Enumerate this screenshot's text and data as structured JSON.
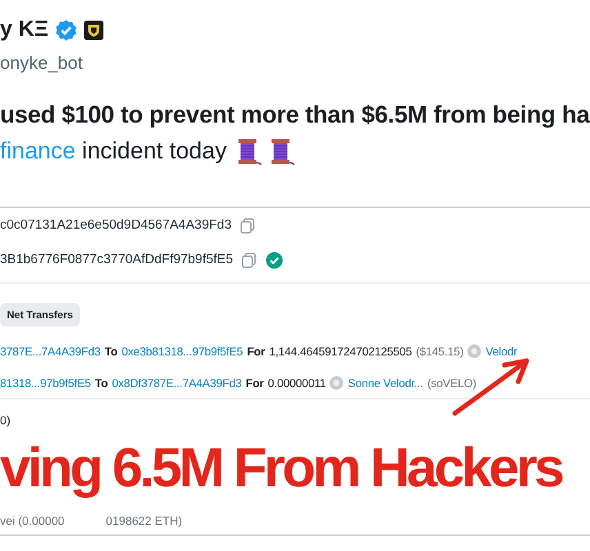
{
  "tweet": {
    "author_name": "y KΞ",
    "verified": true,
    "handle": "onyke_bot",
    "text_line_1": "used $100 to prevent more than $6.5M from being ha",
    "text_line_2": [
      {
        "kind": "link",
        "text": "finance"
      },
      {
        "kind": "plain",
        "text": " incident today"
      },
      {
        "kind": "spool"
      },
      {
        "kind": "spool"
      }
    ]
  },
  "addresses": [
    {
      "text": "c0c07131A21e6e50d9D4567A4A39Fd3",
      "verified": false
    },
    {
      "text": "3B1b6776F0877c3770AfDdFf97b9f5fE5",
      "verified": true
    }
  ],
  "tabs": [
    {
      "label": "Net Transfers",
      "selected": true
    }
  ],
  "transfers": [
    {
      "segments": [
        {
          "kind": "link",
          "text": "3787E...7A4A39Fd3"
        },
        {
          "kind": "keyword",
          "text": "To"
        },
        {
          "kind": "link",
          "text": "0xe3b81318...97b9f5fE5"
        },
        {
          "kind": "keyword",
          "text": "For"
        },
        {
          "kind": "amount",
          "text": "1,144.464591724702125505"
        },
        {
          "kind": "muted",
          "text": "($145.15)"
        },
        {
          "kind": "token"
        },
        {
          "kind": "link",
          "text": "Velodr"
        }
      ]
    },
    {
      "segments": [
        {
          "kind": "link",
          "text": "81318...97b9f5fE5"
        },
        {
          "kind": "keyword",
          "text": "To"
        },
        {
          "kind": "link",
          "text": "0x8Df3787E...7A4A39Fd3"
        },
        {
          "kind": "keyword",
          "text": "For"
        },
        {
          "kind": "amount",
          "text": "0.00000011"
        },
        {
          "kind": "token"
        },
        {
          "kind": "link",
          "text": "Sonne Velodr..."
        },
        {
          "kind": "muted",
          "text": "(soVELO)"
        }
      ]
    }
  ],
  "fee": "0)",
  "gas": [
    "vei (0.00000",
    "0198622 ETH)"
  ],
  "caption": "ving 6.5M From Hackers"
}
